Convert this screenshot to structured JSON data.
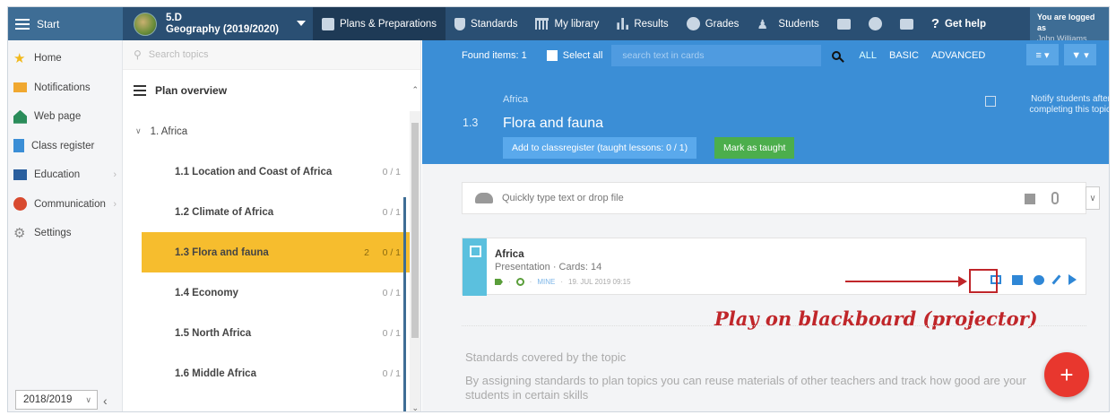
{
  "topbar": {
    "start_label": "Start",
    "class_line1": "5.D",
    "class_line2": "Geography (2019/2020)",
    "nav": [
      {
        "label": "Plans & Preparations",
        "icon": "plans-icon"
      },
      {
        "label": "Standards",
        "icon": "shield-icon"
      },
      {
        "label": "My library",
        "icon": "library-icon"
      },
      {
        "label": "Results",
        "icon": "bar-chart-icon"
      },
      {
        "label": "Grades",
        "icon": "grades-icon"
      },
      {
        "label": "Students",
        "icon": "students-icon"
      }
    ],
    "help_label": "Get help",
    "user_line1": "You are logged as",
    "user_line2": "John Williams"
  },
  "sidebar": {
    "items": [
      {
        "label": "Home"
      },
      {
        "label": "Notifications"
      },
      {
        "label": "Web page"
      },
      {
        "label": "Class register"
      },
      {
        "label": "Education"
      },
      {
        "label": "Communication"
      },
      {
        "label": "Settings"
      }
    ],
    "year": "2018/2019"
  },
  "topics": {
    "search_placeholder": "Search topics",
    "plan_overview": "Plan overview",
    "group": "1. Africa",
    "items": [
      {
        "label": "1.1 Location and Coast of Africa",
        "count": "0 / 1"
      },
      {
        "label": "1.2 Climate of Africa",
        "count": "0 / 1"
      },
      {
        "label": "1.3 Flora and fauna",
        "count": "0 / 1",
        "badge": "2"
      },
      {
        "label": "1.4 Economy",
        "count": "0 / 1"
      },
      {
        "label": "1.5 North Africa",
        "count": "0 / 1"
      },
      {
        "label": "1.6 Middle Africa",
        "count": "0 / 1"
      }
    ]
  },
  "main": {
    "found_items": "Found items: 1",
    "select_all": "Select all",
    "search_placeholder": "search text in cards",
    "filters": [
      "ALL",
      "BASIC",
      "ADVANCED"
    ],
    "breadcrumb": "Africa",
    "topic_number": "1.3",
    "topic_title": "Flora and fauna",
    "add_button": "Add to classregister (taught lessons: 0 / 1)",
    "mark_button": "Mark as taught",
    "notify": "Notify students after completing this topic",
    "drop_placeholder": "Quickly type text or drop file",
    "card": {
      "title": "Africa",
      "subtitle": "Presentation · Cards: 14",
      "meta_author": "MINE",
      "meta_date": "19. JUL 2019 09:15"
    },
    "annotation": "Play on blackboard (projector)",
    "standards_title": "Standards covered by the topic",
    "standards_desc": "By assigning standards to plan topics you can reuse materials of other teachers and track how good are your students in certain skills"
  },
  "colors": {
    "topbar": "#2a4f73",
    "header_blue": "#3b8ed6",
    "active_topic": "#f6bd2e",
    "mark_green": "#4cae4c",
    "fab_red": "#e8372e",
    "annotation_red": "#c0262a"
  }
}
